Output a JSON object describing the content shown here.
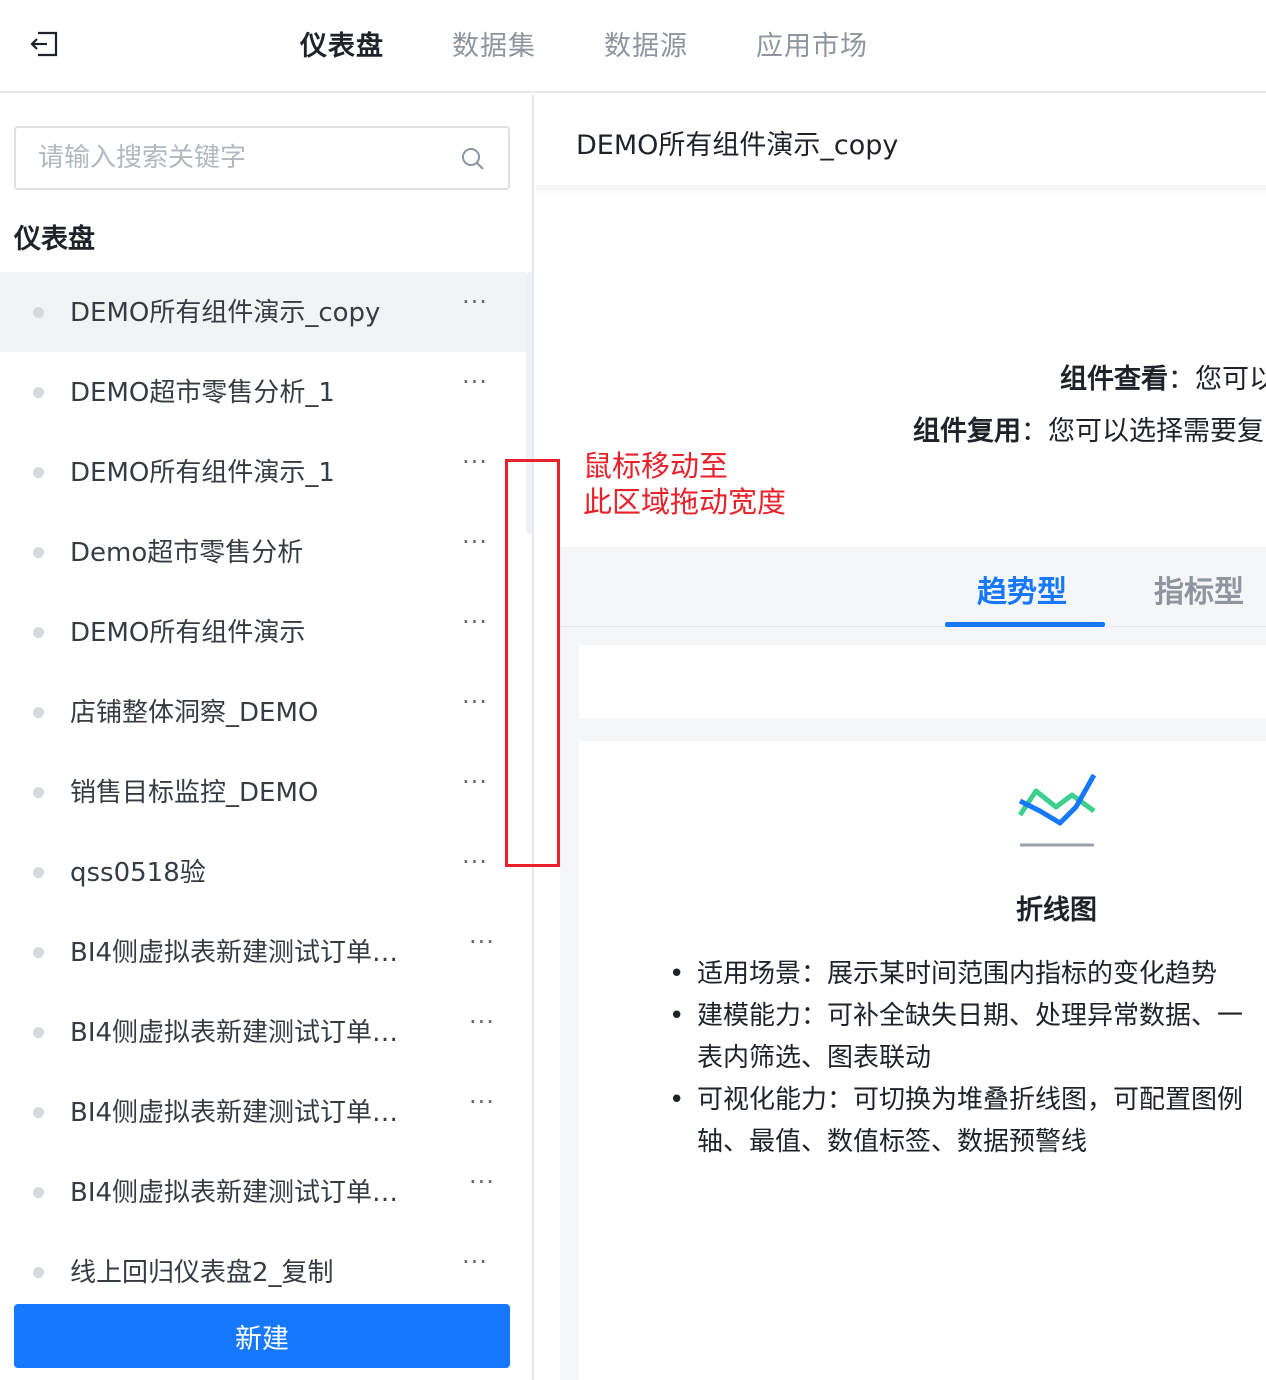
{
  "topnav": {
    "tabs": [
      {
        "label": "仪表盘",
        "active": true
      },
      {
        "label": "数据集",
        "active": false
      },
      {
        "label": "数据源",
        "active": false
      },
      {
        "label": "应用市场",
        "active": false
      }
    ]
  },
  "sidebar": {
    "search_placeholder": "请输入搜索关键字",
    "section_title": "仪表盘",
    "items": [
      {
        "label": "DEMO所有组件演示_copy",
        "selected": true
      },
      {
        "label": "DEMO超市零售分析_1"
      },
      {
        "label": "DEMO所有组件演示_1"
      },
      {
        "label": "Demo超市零售分析"
      },
      {
        "label": "DEMO所有组件演示"
      },
      {
        "label": "店铺整体洞察_DEMO"
      },
      {
        "label": "销售目标监控_DEMO"
      },
      {
        "label": "qss0518验"
      },
      {
        "label": "BI4侧虚拟表新建测试订单…"
      },
      {
        "label": "BI4侧虚拟表新建测试订单…"
      },
      {
        "label": "BI4侧虚拟表新建测试订单…"
      },
      {
        "label": "BI4侧虚拟表新建测试订单…"
      },
      {
        "label": "线上回归仪表盘2_复制"
      }
    ],
    "more_label": "···",
    "new_button": "新建"
  },
  "main": {
    "title": "DEMO所有组件演示_copy",
    "hint_view_label": "组件查看",
    "hint_view_text": "您可以",
    "hint_reuse_label": "组件复用",
    "hint_reuse_text": "您可以选择需要复",
    "hint_colon": "：",
    "type_tabs": [
      {
        "label": "趋势型",
        "active": true
      },
      {
        "label": "指标型",
        "active": false
      }
    ],
    "card": {
      "icon": "line-chart-icon",
      "name": "折线图",
      "bullets": [
        "适用场景：展示某时间范围内指标的变化趋势",
        "建模能力：可补全缺失日期、处理异常数据、一",
        "表内筛选、图表联动",
        "可视化能力：可切换为堆叠折线图，可配置图例",
        "轴、最值、数值标签、数据预警线"
      ]
    }
  },
  "annotation": {
    "line1": "鼠标移动至",
    "line2": "此区域拖动宽度",
    "color": "#e8212b"
  },
  "colors": {
    "accent": "#1677ff",
    "chart_line_blue": "#1677ff",
    "chart_line_green": "#3ccf8e"
  }
}
